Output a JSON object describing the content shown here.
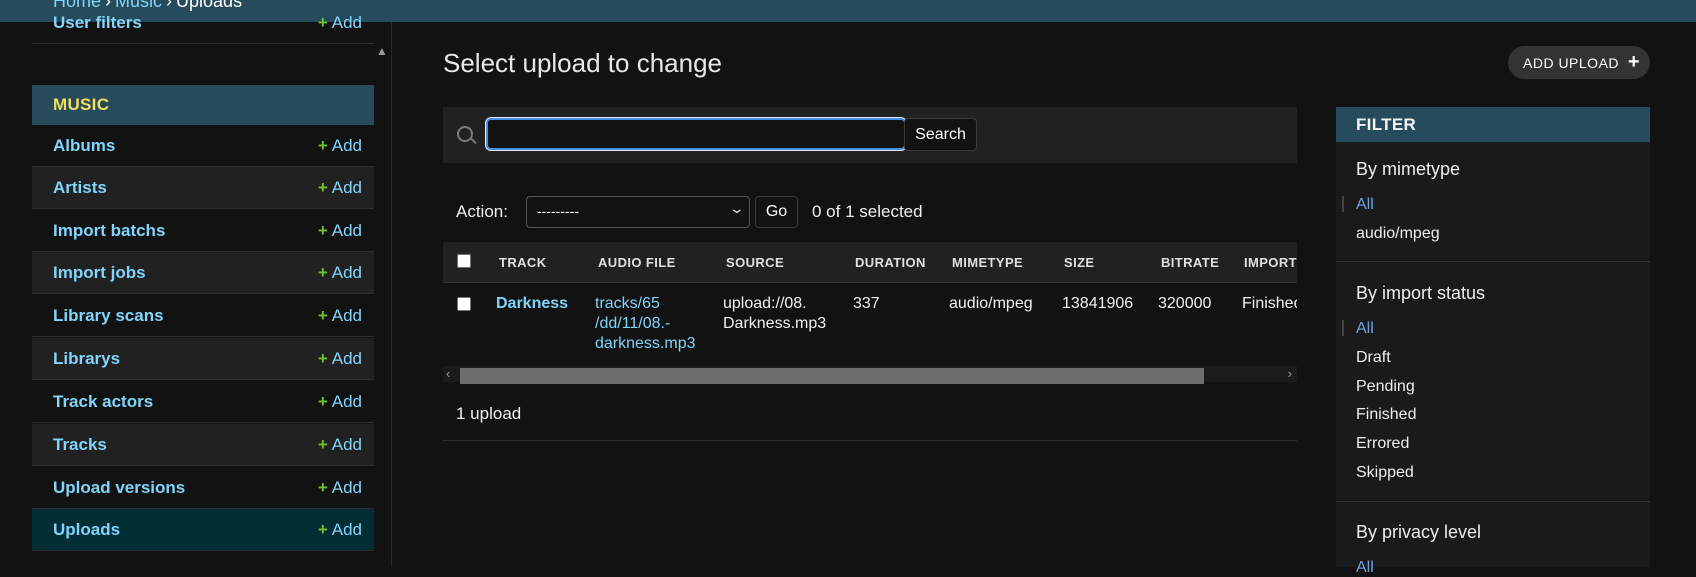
{
  "breadcrumbs": [
    "Home",
    "Music",
    "Uploads"
  ],
  "sidebar": {
    "partial_item": {
      "label": "User filters",
      "add": "Add"
    },
    "section_caption": "MUSIC",
    "items": [
      {
        "label": "Albums",
        "add": "Add"
      },
      {
        "label": "Artists",
        "add": "Add"
      },
      {
        "label": "Import batchs",
        "add": "Add"
      },
      {
        "label": "Import jobs",
        "add": "Add"
      },
      {
        "label": "Library scans",
        "add": "Add"
      },
      {
        "label": "Librarys",
        "add": "Add"
      },
      {
        "label": "Track actors",
        "add": "Add"
      },
      {
        "label": "Tracks",
        "add": "Add"
      },
      {
        "label": "Upload versions",
        "add": "Add"
      },
      {
        "label": "Uploads",
        "add": "Add"
      }
    ]
  },
  "main": {
    "title": "Select upload to change",
    "add_button": "ADD UPLOAD",
    "search": {
      "value": "",
      "button": "Search"
    },
    "actions": {
      "label": "Action:",
      "selected_option": "---------",
      "go": "Go",
      "selected_count": "0 of 1 selected"
    },
    "table": {
      "headers": [
        "TRACK",
        "AUDIO FILE",
        "SOURCE",
        "DURATION",
        "MIMETYPE",
        "SIZE",
        "BITRATE",
        "IMPORT"
      ],
      "row": {
        "track": "Darkness",
        "audio_file_1": "tracks/65",
        "audio_file_2": "/dd/11/08.-",
        "audio_file_3": "darkness.mp3",
        "source_1": "upload://08.",
        "source_2": "Darkness.mp3",
        "duration": "337",
        "mimetype": "audio/mpeg",
        "size": "13841906",
        "bitrate": "320000",
        "import_status": "Finished"
      }
    },
    "paginator": "1 upload"
  },
  "filter": {
    "title": "FILTER",
    "groups": [
      {
        "title": "By mimetype",
        "options": [
          "All",
          "audio/mpeg"
        ]
      },
      {
        "title": "By import status",
        "options": [
          "All",
          "Draft",
          "Pending",
          "Finished",
          "Errored",
          "Skipped"
        ]
      },
      {
        "title": "By privacy level",
        "options": [
          "All"
        ]
      }
    ]
  },
  "colors": {
    "header": "#264b5d",
    "link": "#81d4fa",
    "add_plus": "#70bf2b",
    "caption": "#f5dd5d",
    "selected_filter": "#6fa3e0"
  }
}
